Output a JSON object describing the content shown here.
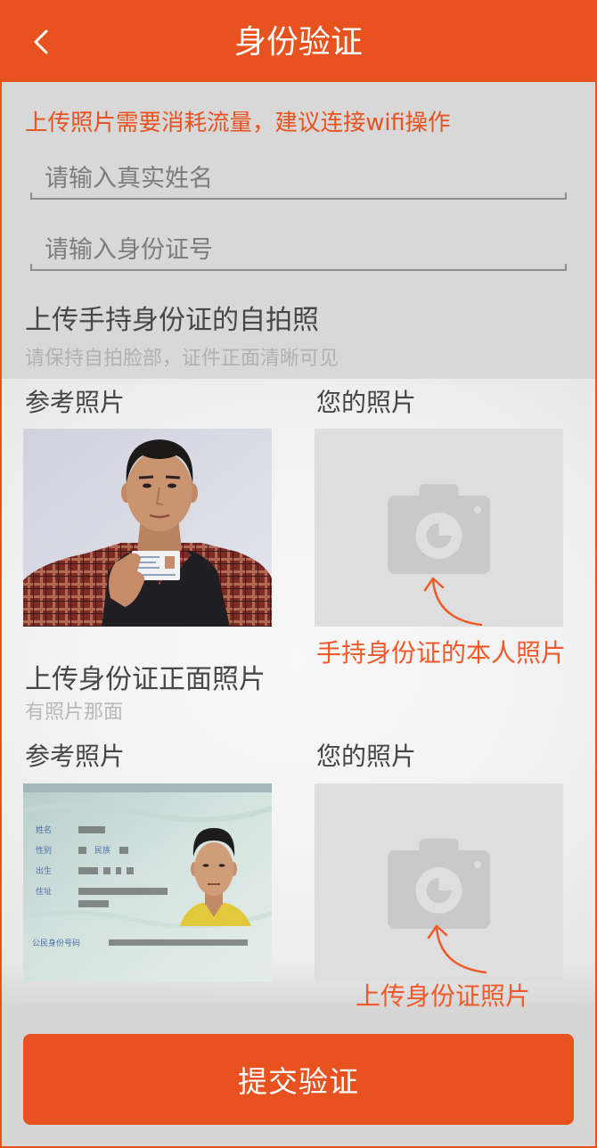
{
  "header": {
    "title": "身份验证",
    "back_icon": "chevron-left-icon"
  },
  "notice": "上传照片需要消耗流量，建议连接wifi操作",
  "form": {
    "name_field": {
      "placeholder": "请输入真实姓名"
    },
    "id_field": {
      "placeholder": "请输入身份证号"
    }
  },
  "selfie_section": {
    "title": "上传手持身份证的自拍照",
    "hint": "请保持自拍脸部，证件正面清晰可见",
    "reference_label": "参考照片",
    "your_label": "您的照片",
    "upload_icon": "camera-icon"
  },
  "id_front_section": {
    "title": "上传身份证正面照片",
    "hint": "有照片那面",
    "reference_label": "参考照片",
    "your_label": "您的照片",
    "upload_icon": "camera-icon",
    "sample_card_labels": {
      "name": "姓名",
      "sex": "性别",
      "ethnicity": "民族",
      "birth": "出生",
      "address": "住址",
      "id_number": "公民身份号码"
    }
  },
  "guide_overlay": {
    "selfie_tip": "手持身份证的本人照片",
    "id_card_tip": "上传身份证照片",
    "arrow_icon": "curved-arrow-icon"
  },
  "submit_button": {
    "label": "提交验证"
  },
  "colors": {
    "brand": "#E8521E",
    "annotation": "#F05A2A",
    "overlay": "#D8D8D8",
    "placeholder_box": "#DEDEDE",
    "camera_icon": "#C9C9C9"
  }
}
